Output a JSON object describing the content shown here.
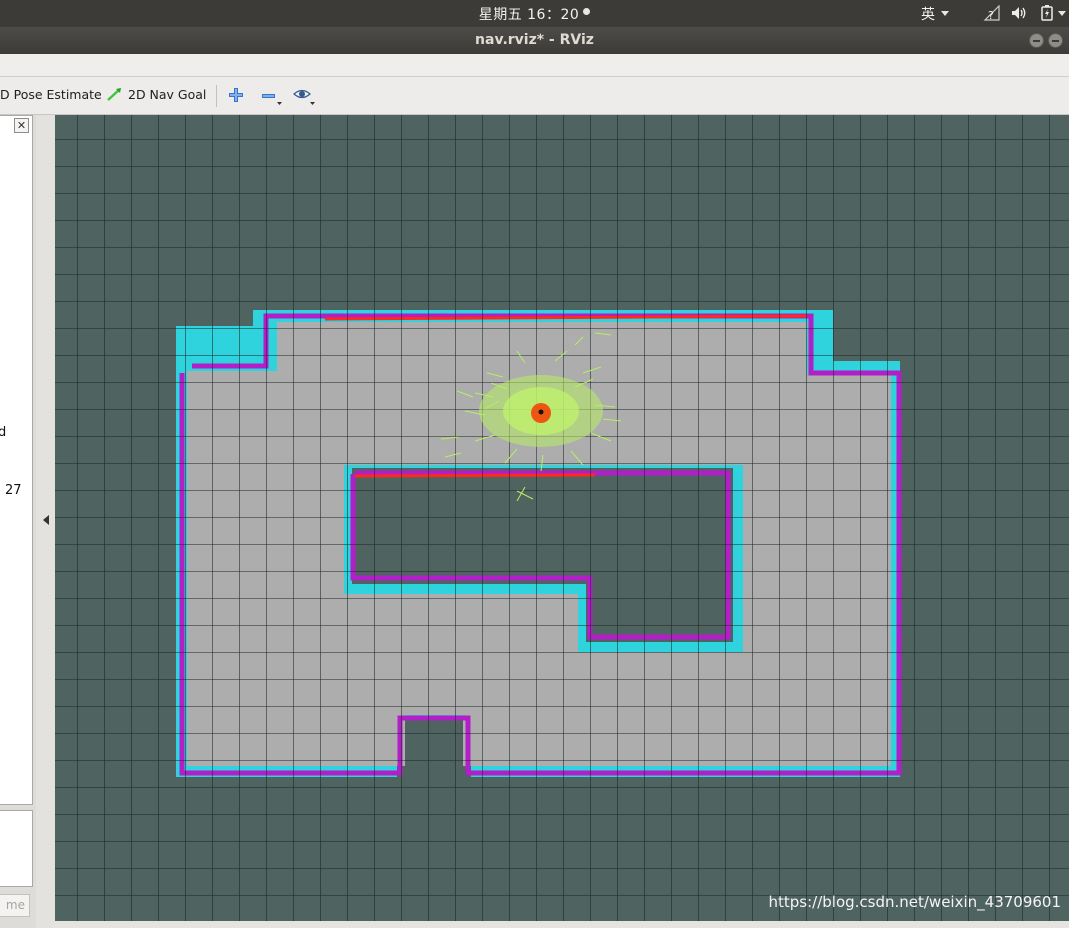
{
  "topbar": {
    "clock": "星期五 16：20",
    "input_method": "英"
  },
  "window": {
    "title": "nav.rviz* - RViz"
  },
  "toolbar": {
    "pose_estimate_label": "D Pose Estimate",
    "nav_goal_label": "2D Nav Goal",
    "pose_estimate_color": "#cc2a2a",
    "nav_goal_color": "#3cc43c"
  },
  "left_panel": {
    "fragment_1": "d",
    "fragment_2": "27",
    "name_button": "me"
  },
  "viewport": {
    "watermark": "https://blog.csdn.net/weixin_43709601",
    "colors": {
      "background": "#4f6361",
      "free_space": "#adadad",
      "inflation": "#2fd3dd",
      "obstacle": "#b21ec7",
      "laser": "#ff2a1a",
      "particles": "#b6ef62",
      "robot": "#ee5511"
    }
  }
}
